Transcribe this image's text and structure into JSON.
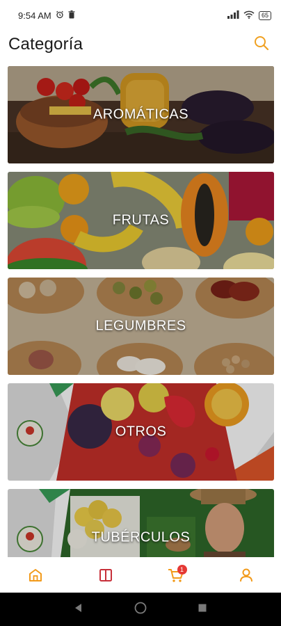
{
  "status_bar": {
    "time": "9:54 AM",
    "battery": "65"
  },
  "header": {
    "title": "Categoría"
  },
  "categories": [
    {
      "label": "AROMÁTICAS"
    },
    {
      "label": "FRUTAS"
    },
    {
      "label": "LEGUMBRES"
    },
    {
      "label": "OTROS"
    },
    {
      "label": "TUBÉRCULOS"
    }
  ],
  "bottom_nav": {
    "items": [
      "home-icon",
      "catalog-icon",
      "cart-icon",
      "profile-icon"
    ],
    "cart_badge": "1"
  },
  "colors": {
    "accent": "#f0a020",
    "nav_icon": "#f29a1a",
    "catalog_icon": "#c7303a",
    "badge": "#e53935"
  }
}
